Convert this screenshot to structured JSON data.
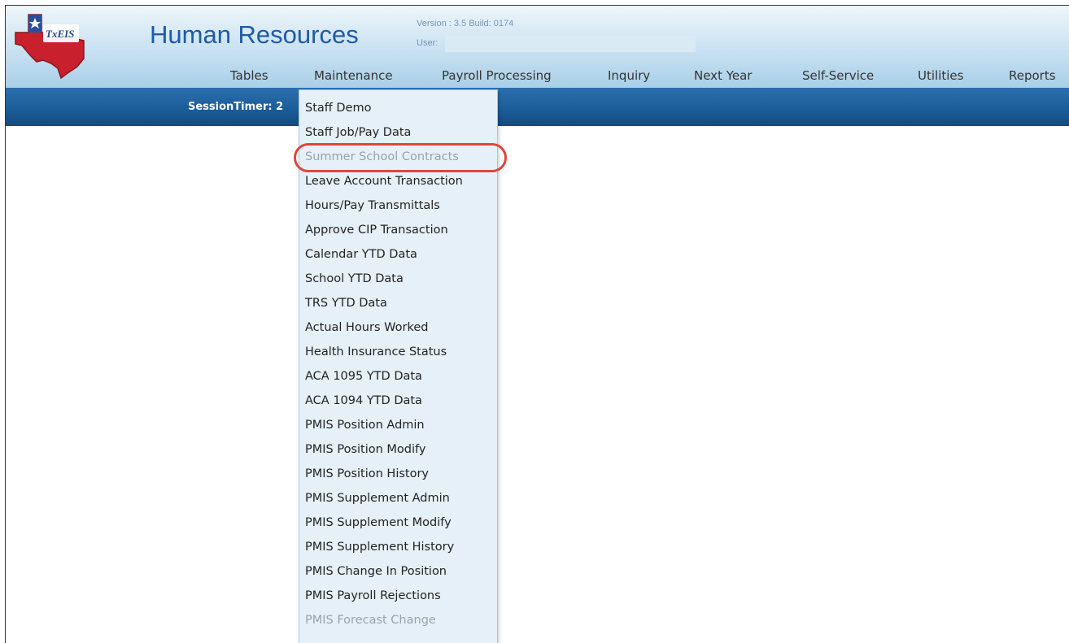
{
  "app": {
    "title": "Human Resources",
    "version": "Version : 3.5 Build: 0174",
    "user_label": "User:",
    "user_value": ""
  },
  "nav": {
    "items": [
      "Tables",
      "Maintenance",
      "Payroll Processing",
      "Inquiry",
      "Next Year",
      "Self-Service",
      "Utilities",
      "Reports"
    ]
  },
  "session": {
    "timer_text": "SessionTimer: 2"
  },
  "dropdown": {
    "items": [
      {
        "label": "Staff Demo",
        "enabled": true
      },
      {
        "label": "Staff Job/Pay Data",
        "enabled": true
      },
      {
        "label": "Summer School Contracts",
        "enabled": false,
        "highlighted": true
      },
      {
        "label": "Leave Account Transaction",
        "enabled": true
      },
      {
        "label": "Hours/Pay Transmittals",
        "enabled": true
      },
      {
        "label": "Approve CIP Transaction",
        "enabled": true
      },
      {
        "label": "Calendar YTD Data",
        "enabled": true
      },
      {
        "label": "School YTD Data",
        "enabled": true
      },
      {
        "label": "TRS YTD Data",
        "enabled": true
      },
      {
        "label": "Actual Hours Worked",
        "enabled": true
      },
      {
        "label": "Health Insurance Status",
        "enabled": true
      },
      {
        "label": "ACA 1095 YTD Data",
        "enabled": true
      },
      {
        "label": "ACA 1094 YTD Data",
        "enabled": true
      },
      {
        "label": "PMIS Position Admin",
        "enabled": true
      },
      {
        "label": "PMIS Position Modify",
        "enabled": true
      },
      {
        "label": "PMIS Position History",
        "enabled": true
      },
      {
        "label": "PMIS Supplement Admin",
        "enabled": true
      },
      {
        "label": "PMIS Supplement Modify",
        "enabled": true
      },
      {
        "label": "PMIS Supplement History",
        "enabled": true
      },
      {
        "label": "PMIS Change In Position",
        "enabled": true
      },
      {
        "label": "PMIS Payroll Rejections",
        "enabled": true
      },
      {
        "label": "PMIS Forecast Change",
        "enabled": false
      }
    ]
  },
  "logo": {
    "text": "TxEIS"
  },
  "colors": {
    "header_title": "#1f5aa6",
    "bluebar": "#1b5b97",
    "dropdown_bg": "#e6f0f8",
    "highlight_oval": "#e0453c"
  }
}
